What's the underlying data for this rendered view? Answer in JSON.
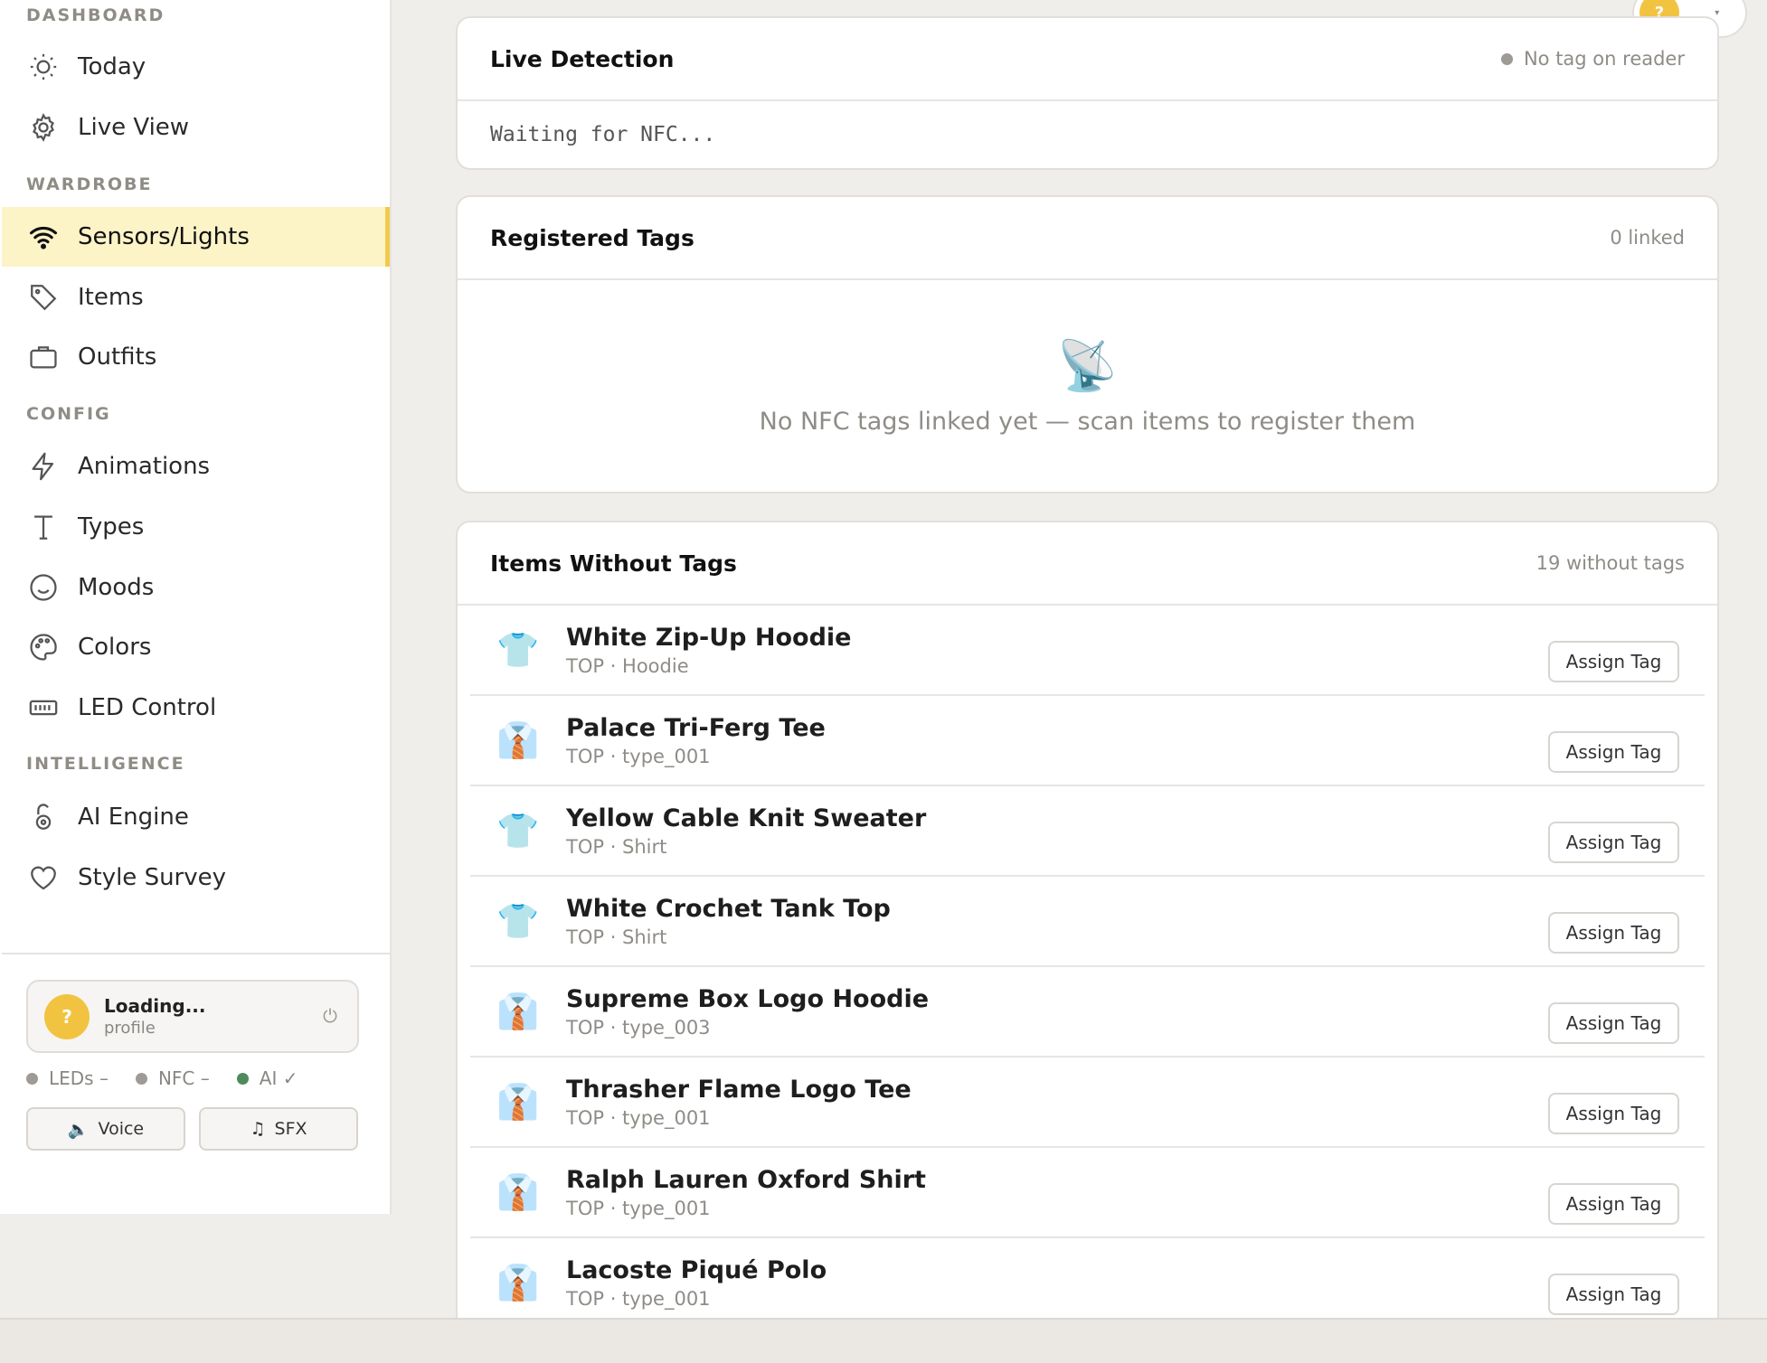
{
  "sidebar": {
    "sections": {
      "dashboard": "DASHBOARD",
      "wardrobe": "WARDROBE",
      "config": "CONFIG",
      "intelligence": "INTELLIGENCE"
    },
    "items": {
      "today": "Today",
      "live_view": "Live View",
      "sensors": "Sensors/Lights",
      "items": "Items",
      "outfits": "Outfits",
      "animations": "Animations",
      "types": "Types",
      "moods": "Moods",
      "colors": "Colors",
      "led_control": "LED Control",
      "ai_engine": "AI Engine",
      "style_survey": "Style Survey"
    },
    "active_item": "Sensors/Lights",
    "profile": {
      "avatar": "?",
      "name": "Loading...",
      "sub": "profile"
    },
    "status": [
      {
        "label": "LEDs –",
        "color": "#9e9b96"
      },
      {
        "label": "NFC –",
        "color": "#9e9b96"
      },
      {
        "label": "AI ✓",
        "color": "#4f8a5b"
      }
    ],
    "buttons": {
      "voice": "Voice",
      "sfx": "SFX"
    }
  },
  "user_chip": {
    "avatar": "?",
    "dots": "..."
  },
  "live_detection": {
    "title": "Live Detection",
    "status": "No tag on reader",
    "status_color": "#9e9b96",
    "body": "Waiting for NFC..."
  },
  "registered_tags": {
    "title": "Registered Tags",
    "meta": "0 linked",
    "empty_icon": "📡",
    "empty_text": "No NFC tags linked yet — scan items to register them"
  },
  "items_without_tags": {
    "title": "Items Without Tags",
    "meta": "19 without tags",
    "button_label": "Assign Tag",
    "rows": [
      {
        "icon": "👕",
        "name": "White Zip-Up Hoodie",
        "sub": "TOP · Hoodie"
      },
      {
        "icon": "👔",
        "name": "Palace Tri-Ferg Tee",
        "sub": "TOP · type_001"
      },
      {
        "icon": "👕",
        "name": "Yellow Cable Knit Sweater",
        "sub": "TOP · Shirt"
      },
      {
        "icon": "👕",
        "name": "White Crochet Tank Top",
        "sub": "TOP · Shirt"
      },
      {
        "icon": "👔",
        "name": "Supreme Box Logo Hoodie",
        "sub": "TOP · type_003"
      },
      {
        "icon": "👔",
        "name": "Thrasher Flame Logo Tee",
        "sub": "TOP · type_001"
      },
      {
        "icon": "👔",
        "name": "Ralph Lauren Oxford Shirt",
        "sub": "TOP · type_001"
      },
      {
        "icon": "👔",
        "name": "Lacoste Piqué Polo",
        "sub": "TOP · type_001"
      }
    ]
  }
}
